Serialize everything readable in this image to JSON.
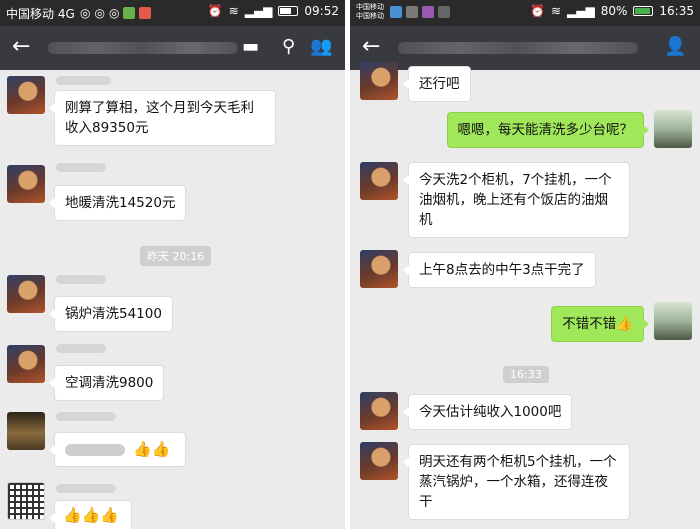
{
  "left": {
    "status": {
      "carrier": "中国移动 4G",
      "time": "09:52"
    },
    "messages": [
      "刚算了算相，这个月到今天毛利收入89350元",
      "地暖清洗14520元",
      "锅炉清洗54100",
      "空调清洗9800"
    ],
    "timestamp": "昨天 20:16",
    "thumbs_row1": "👍👍",
    "thumbs_row2": "👍👍👍"
  },
  "right": {
    "status": {
      "carrier_line1": "中国移动",
      "carrier_line2": "中国移动",
      "battery": "80%",
      "time": "16:35"
    },
    "timestamp": "16:33",
    "messages": [
      {
        "side": "in",
        "text": "还行吧"
      },
      {
        "side": "out",
        "text": "嗯嗯，每天能清洗多少台呢？"
      },
      {
        "side": "in",
        "text": "今天洗2个柜机，7个挂机，一个油烟机，晚上还有个饭店的油烟机"
      },
      {
        "side": "in",
        "text": "上午8点去的中午3点干完了"
      },
      {
        "side": "out",
        "text": "不错不错👍"
      },
      {
        "side": "in",
        "text": "今天估计纯收入1000吧"
      },
      {
        "side": "in",
        "text": "明天还有两个柜机5个挂机，一个蒸汽锅炉，一个水箱，还得连夜干"
      }
    ]
  }
}
